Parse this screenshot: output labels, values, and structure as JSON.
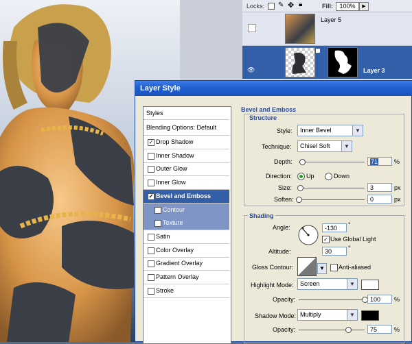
{
  "layers_panel": {
    "locks_label": "Locks:",
    "fill_label": "Fill:",
    "fill_value": "100%",
    "layers": [
      {
        "name": "Layer 5",
        "selected": false
      },
      {
        "name": "Layer 3",
        "selected": true
      }
    ]
  },
  "dialog": {
    "title": "Layer Style",
    "styles_header": "Styles",
    "style_items": [
      {
        "label": "Blending Options: Default",
        "checkbox": false,
        "checked": false,
        "state": "normal"
      },
      {
        "label": "Drop Shadow",
        "checkbox": true,
        "checked": true,
        "state": "normal"
      },
      {
        "label": "Inner Shadow",
        "checkbox": true,
        "checked": false,
        "state": "normal"
      },
      {
        "label": "Outer Glow",
        "checkbox": true,
        "checked": false,
        "state": "normal"
      },
      {
        "label": "Inner Glow",
        "checkbox": true,
        "checked": false,
        "state": "normal"
      },
      {
        "label": "Bevel and Emboss",
        "checkbox": true,
        "checked": true,
        "state": "selected"
      },
      {
        "label": "Contour",
        "checkbox": true,
        "checked": false,
        "state": "sub"
      },
      {
        "label": "Texture",
        "checkbox": true,
        "checked": false,
        "state": "sub"
      },
      {
        "label": "Satin",
        "checkbox": true,
        "checked": false,
        "state": "normal"
      },
      {
        "label": "Color Overlay",
        "checkbox": true,
        "checked": false,
        "state": "normal"
      },
      {
        "label": "Gradient Overlay",
        "checkbox": true,
        "checked": false,
        "state": "normal"
      },
      {
        "label": "Pattern Overlay",
        "checkbox": true,
        "checked": false,
        "state": "normal"
      },
      {
        "label": "Stroke",
        "checkbox": true,
        "checked": false,
        "state": "normal"
      }
    ],
    "bevel": {
      "section_title": "Bevel and Emboss",
      "structure": {
        "title": "Structure",
        "style_label": "Style:",
        "style_value": "Inner Bevel",
        "technique_label": "Technique:",
        "technique_value": "Chisel Soft",
        "depth_label": "Depth:",
        "depth_value": "71",
        "depth_unit": "%",
        "depth_level": 0.05,
        "direction_label": "Direction:",
        "direction_up": "Up",
        "direction_down": "Down",
        "direction_selected": "Up",
        "size_label": "Size:",
        "size_value": "3",
        "size_unit": "px",
        "size_level": 0.02,
        "soften_label": "Soften:",
        "soften_value": "0",
        "soften_unit": "px",
        "soften_level": 0.0
      },
      "shading": {
        "title": "Shading",
        "angle_label": "Angle:",
        "angle_value": "-130",
        "angle_unit": "°",
        "use_global_light_label": "Use Global Light",
        "use_global_light_checked": true,
        "altitude_label": "Altitude:",
        "altitude_value": "30",
        "altitude_unit": "°",
        "gloss_contour_label": "Gloss Contour:",
        "anti_aliased_label": "Anti-aliased",
        "anti_aliased_checked": false,
        "highlight_mode_label": "Highlight Mode:",
        "highlight_mode_value": "Screen",
        "highlight_color": "#ffffff",
        "highlight_opacity_label": "Opacity:",
        "highlight_opacity_value": "100",
        "highlight_opacity_unit": "%",
        "highlight_opacity_level": 1.0,
        "shadow_mode_label": "Shadow Mode:",
        "shadow_mode_value": "Multiply",
        "shadow_color": "#000000",
        "shadow_opacity_label": "Opacity:",
        "shadow_opacity_value": "75",
        "shadow_opacity_unit": "%",
        "shadow_opacity_level": 0.75
      }
    }
  },
  "colors": {
    "titlebar": "#1f5fd0",
    "selected_item": "#335ea8",
    "section_title": "#2a4a9a"
  }
}
